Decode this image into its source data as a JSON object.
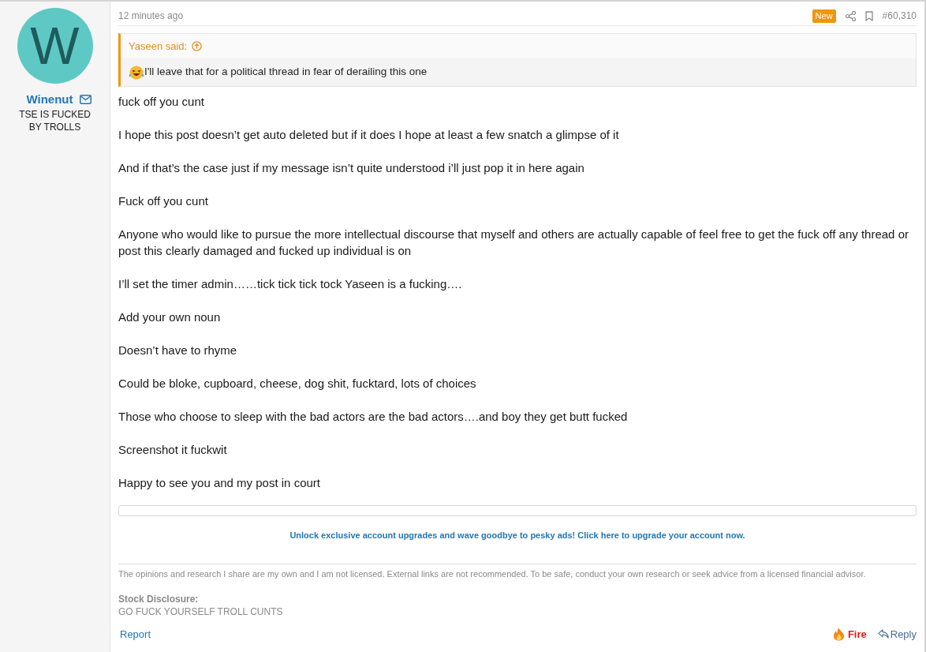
{
  "author": {
    "avatar_letter": "W",
    "name": "Winenut",
    "title": "TSE IS FUCKED BY TROLLS"
  },
  "post": {
    "time": "12 minutes ago",
    "badge": "New",
    "number": "#60,310"
  },
  "quote": {
    "author_line": "Yaseen said:",
    "text": "I'll leave that for a political thread in fear of derailing this one"
  },
  "paragraphs": [
    "fuck off you cunt",
    "I hope this post doesn’t get auto deleted but if it does I hope at least a few snatch a glimpse of it",
    "And if that’s the case just if my message isn’t quite understood i’ll just pop it in here again",
    "Fuck off you cunt",
    "Anyone who would like to pursue the more intellectual discourse that myself and others are actually capable of feel free to get the fuck off any thread or post this clearly damaged and fucked up individual is on",
    "I’ll set the timer admin……tick tick tick tock Yaseen is a fucking….",
    "Add your own noun",
    "Doesn’t have to rhyme",
    "Could be bloke, cupboard, cheese, dog shit, fucktard, lots of choices",
    "Those who choose to sleep with the bad actors are the bad actors….and boy they get butt fucked",
    "Screenshot it fuckwit",
    "Happy to see you and my post in court"
  ],
  "upgrade_link": "Unlock exclusive account upgrades and wave goodbye to pesky ads! Click here to upgrade your account now.",
  "signature": {
    "disclaimer": "The opinions and research I share are my own and I am not licensed. External links are not recommended. To be safe, conduct your own research or seek advice from a licensed financial advisor.",
    "heading": "Stock Disclosure:",
    "body": "GO FUCK YOURSELF TROLL CUNTS"
  },
  "footer": {
    "report": "Report",
    "reaction": "Fire",
    "reply": "Reply"
  }
}
